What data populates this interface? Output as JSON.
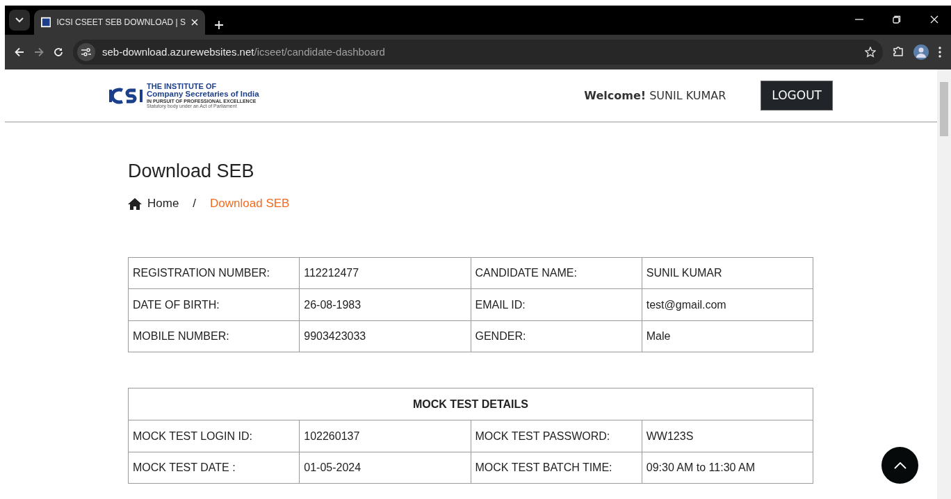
{
  "browser": {
    "tab_title": "ICSI CSEET SEB DOWNLOAD | S",
    "url_host": "seb-download.azurewebsites.net",
    "url_path": "/icseet/candidate-dashboard"
  },
  "header": {
    "logo": {
      "line_1": "THE INSTITUTE OF",
      "line_2": "Company Secretaries of India",
      "line_3": "IN PURSUIT OF PROFESSIONAL EXCELLENCE",
      "line_4": "Statutory body under an Act of Parliament"
    },
    "welcome_label": "Welcome!",
    "user_name": "SUNIL KUMAR",
    "logout_button": "LOGOUT"
  },
  "page_title": "Download SEB",
  "breadcrumb": [
    {
      "label": "Home",
      "selected": false
    },
    {
      "label": "/",
      "kind": "separator"
    },
    {
      "label": "Download SEB",
      "selected": true
    }
  ],
  "candidate_table": {
    "rows": [
      [
        "REGISTRATION NUMBER:",
        "112212477",
        "CANDIDATE NAME:",
        "SUNIL KUMAR"
      ],
      [
        "DATE OF BIRTH:",
        "26-08-1983",
        "EMAIL ID:",
        "test@gmail.com"
      ],
      [
        "MOBILE NUMBER:",
        "9903423033",
        "GENDER:",
        "Male"
      ]
    ]
  },
  "mock_test_table": {
    "heading": "MOCK TEST DETAILS",
    "rows": [
      [
        "MOCK TEST LOGIN ID:",
        "102260137",
        "MOCK TEST PASSWORD:",
        "WW123S"
      ],
      [
        "MOCK TEST DATE :",
        "01-05-2024",
        "MOCK TEST BATCH TIME:",
        "09:30 AM to 11:30 AM"
      ]
    ]
  }
}
